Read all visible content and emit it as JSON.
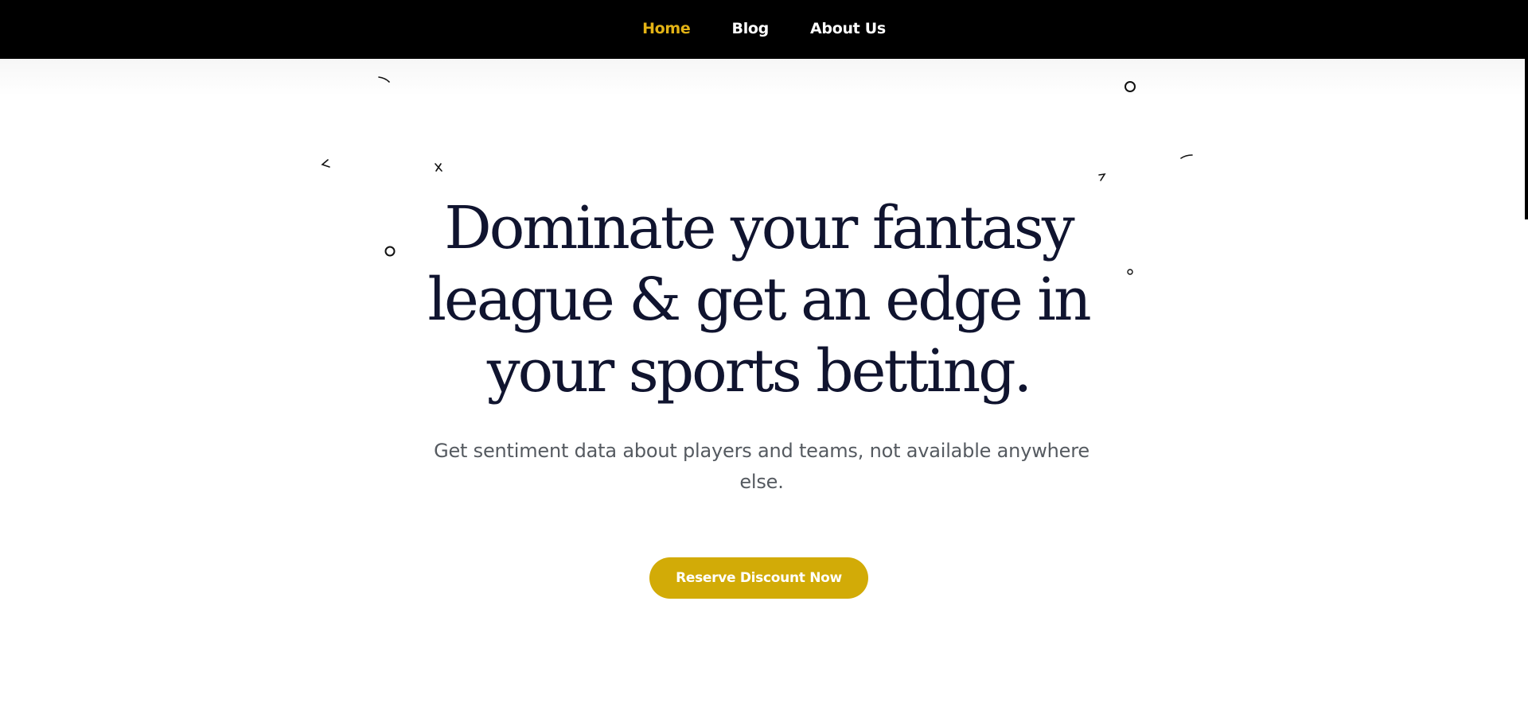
{
  "nav": {
    "items": [
      {
        "label": "Home",
        "active": true
      },
      {
        "label": "Blog",
        "active": false
      },
      {
        "label": "About Us",
        "active": false
      }
    ]
  },
  "hero": {
    "title": "Dominate your fantasy league & get an edge in your sports betting.",
    "subtitle": "Get sentiment data about players and teams, not available anywhere else.",
    "cta_label": "Reserve Discount Now"
  },
  "colors": {
    "nav_background": "#000000",
    "nav_active": "#e3b315",
    "title": "#10142f",
    "subtitle": "#555a60",
    "cta_background": "#d2ab07"
  }
}
